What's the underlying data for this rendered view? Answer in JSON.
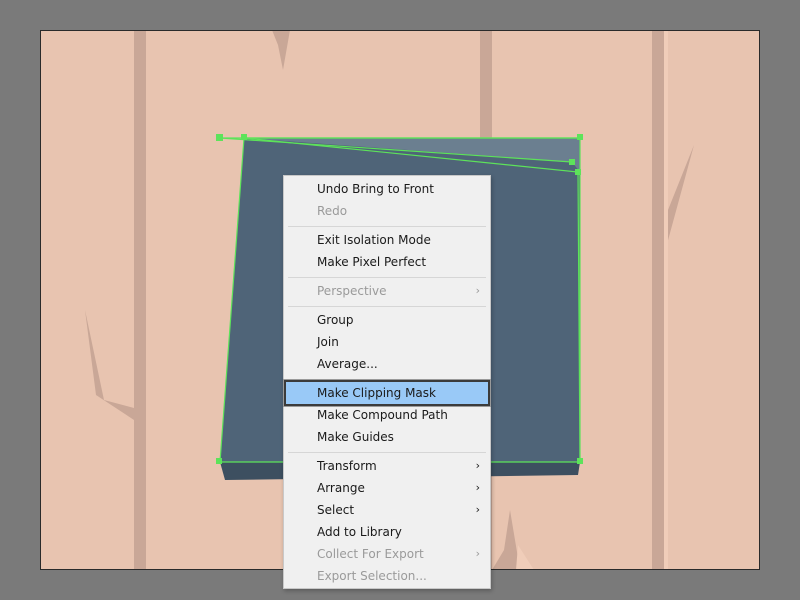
{
  "colors": {
    "canvas_background": "#7a7a7a",
    "artboard_fill": "#e8c4b0",
    "tree_trunk": "#c9a797",
    "tree_highlight": "#f0cdb9",
    "shape_fill": "#4f6478",
    "shape_side": "#3d4f60",
    "shape_top": "#6b7f90",
    "selection_outline": "#5de35a",
    "menu_background": "#f0f0f0",
    "menu_highlight": "#99c9f7",
    "menu_disabled_text": "#9a9a9a"
  },
  "context_menu": {
    "items": [
      {
        "label": "Undo Bring to Front",
        "enabled": true
      },
      {
        "label": "Redo",
        "enabled": false
      },
      {
        "label": "Exit Isolation Mode",
        "enabled": true
      },
      {
        "label": "Make Pixel Perfect",
        "enabled": true
      },
      {
        "label": "Perspective",
        "enabled": false,
        "submenu": true
      },
      {
        "label": "Group",
        "enabled": true
      },
      {
        "label": "Join",
        "enabled": true
      },
      {
        "label": "Average...",
        "enabled": true
      },
      {
        "label": "Make Clipping Mask",
        "enabled": true,
        "highlighted": true
      },
      {
        "label": "Make Compound Path",
        "enabled": true
      },
      {
        "label": "Make Guides",
        "enabled": true
      },
      {
        "label": "Transform",
        "enabled": true,
        "submenu": true
      },
      {
        "label": "Arrange",
        "enabled": true,
        "submenu": true
      },
      {
        "label": "Select",
        "enabled": true,
        "submenu": true
      },
      {
        "label": "Add to Library",
        "enabled": true
      },
      {
        "label": "Collect For Export",
        "enabled": false,
        "submenu": true
      },
      {
        "label": "Export Selection...",
        "enabled": false
      }
    ],
    "submenu_arrow_glyph": "›"
  }
}
